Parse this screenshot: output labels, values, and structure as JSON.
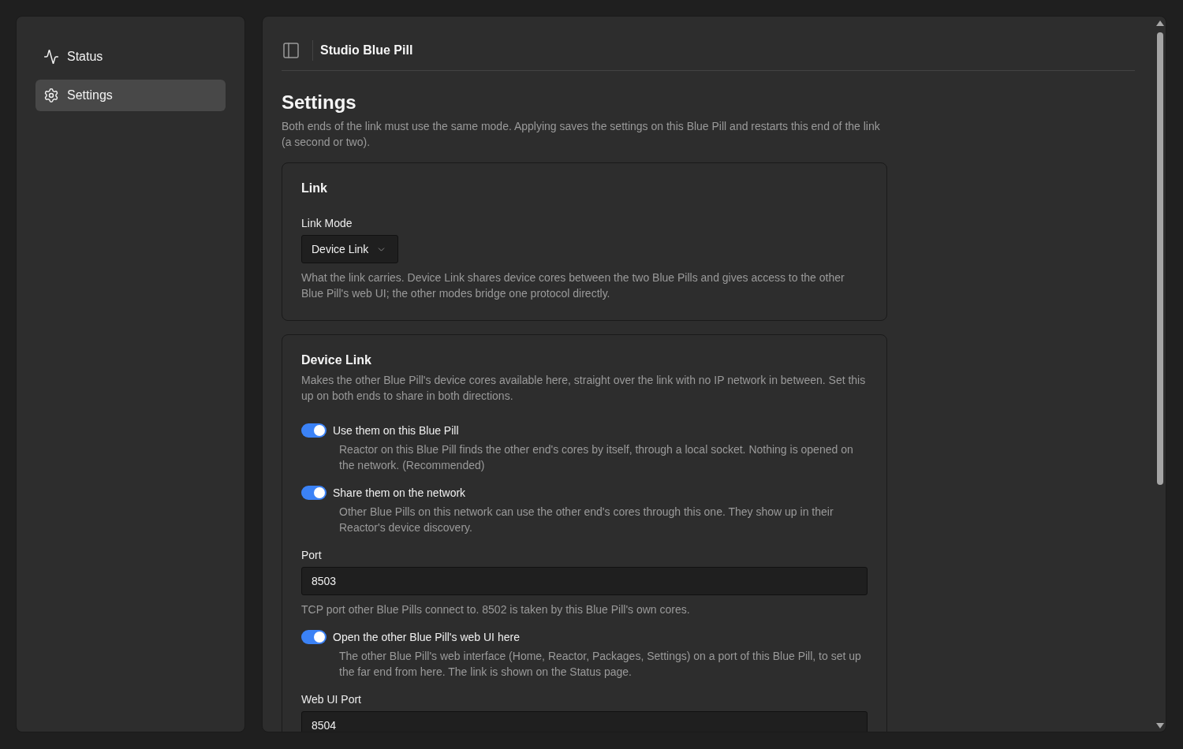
{
  "sidebar": {
    "items": [
      {
        "label": "Status",
        "selected": false
      },
      {
        "label": "Settings",
        "selected": true
      }
    ]
  },
  "header": {
    "title": "Studio Blue Pill"
  },
  "page": {
    "title": "Settings",
    "description": "Both ends of the link must use the same mode. Applying saves the settings on this Blue Pill and restarts this end of the link (a second or two)."
  },
  "sections": [
    {
      "title": "Link",
      "fields": [
        {
          "kind": "select",
          "label": "Link Mode",
          "value": "Device Link",
          "help": "What the link carries. Device Link shares device cores between the two Blue Pills and gives access to the other Blue Pill's web UI; the other modes bridge one protocol directly."
        }
      ]
    },
    {
      "title": "Device Link",
      "description": "Makes the other Blue Pill's device cores available here, straight over the link with no IP network in between. Set this up on both ends to share in both directions.",
      "fields": [
        {
          "kind": "toggle",
          "label": "Use them on this Blue Pill",
          "on": true,
          "help": "Reactor on this Blue Pill finds the other end's cores by itself, through a local socket. Nothing is opened on the network. (Recommended)"
        },
        {
          "kind": "toggle",
          "label": "Share them on the network",
          "on": true,
          "help": "Other Blue Pills on this network can use the other end's cores through this one. They show up in their Reactor's device discovery."
        },
        {
          "kind": "input",
          "label": "Port",
          "value": "8503",
          "help": "TCP port other Blue Pills connect to. 8502 is taken by this Blue Pill's own cores."
        },
        {
          "kind": "toggle",
          "label": "Open the other Blue Pill's web UI here",
          "on": true,
          "help": "The other Blue Pill's web interface (Home, Reactor, Packages, Settings) on a port of this Blue Pill, to set up the far end from here. The link is shown on the Status page."
        },
        {
          "kind": "input",
          "label": "Web UI Port",
          "value": "8504"
        }
      ]
    }
  ]
}
